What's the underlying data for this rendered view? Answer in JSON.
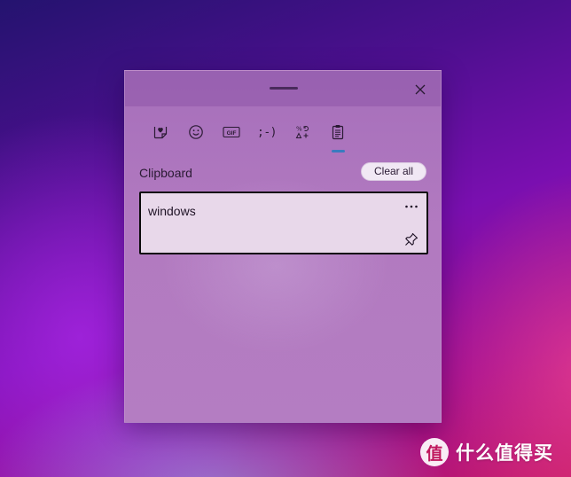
{
  "window": {
    "close_icon": "close-icon",
    "drag_handle": "drag-handle"
  },
  "tabs": [
    {
      "name": "stickers",
      "icon": "heart-sticker-icon",
      "active": false
    },
    {
      "name": "emoji",
      "icon": "smiley-icon",
      "active": false
    },
    {
      "name": "gif",
      "icon": "gif-icon",
      "label": "GIF",
      "active": false
    },
    {
      "name": "kaomoji",
      "icon": "kaomoji-icon",
      "label": ";-)",
      "active": false
    },
    {
      "name": "symbols",
      "icon": "symbols-icon",
      "active": false
    },
    {
      "name": "clipboard",
      "icon": "clipboard-icon",
      "active": true
    }
  ],
  "clipboard": {
    "title": "Clipboard",
    "clear_all_label": "Clear all",
    "items": [
      {
        "text": "windows",
        "more_icon": "ellipsis-icon",
        "pin_icon": "pin-icon"
      }
    ]
  },
  "watermark": {
    "badge": "值",
    "text": "什么值得买"
  },
  "colors": {
    "accent": "#3a7bbf",
    "panel": "#b27ac0",
    "item_bg": "#e8d8ea"
  }
}
